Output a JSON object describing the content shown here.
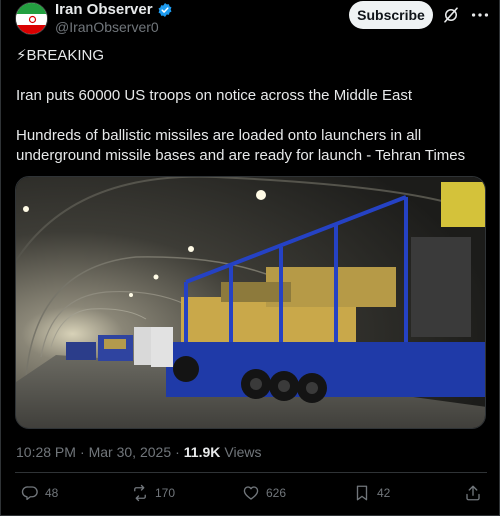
{
  "author": {
    "name": "Iran Observer",
    "handle": "@IranObserver0",
    "verified": true
  },
  "header": {
    "subscribe_label": "Subscribe"
  },
  "post": {
    "line1": "⚡BREAKING",
    "line2": "Iran puts 60000 US troops on notice across the Middle East",
    "line3": "Hundreds of ballistic missiles are loaded onto launchers in all",
    "line4": "underground missile bases and are ready for launch - Tehran Times"
  },
  "meta": {
    "time": "10:28 PM",
    "separator": "·",
    "date": "Mar 30, 2025",
    "separator2": "·",
    "views_count": "11.9K",
    "views_label": "Views"
  },
  "actions": {
    "replies": "48",
    "reposts": "170",
    "likes": "626",
    "bookmarks": "42"
  },
  "colors": {
    "background": "#000000",
    "text": "#e7e9ea",
    "muted": "#71767b",
    "verified": "#1d9bf0",
    "border": "#2f3336"
  }
}
